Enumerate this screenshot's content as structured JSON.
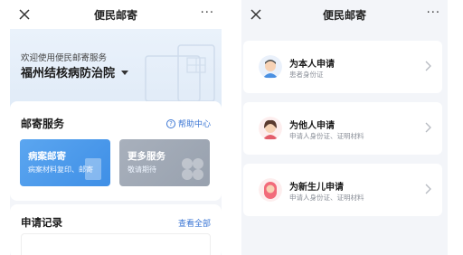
{
  "left": {
    "nav": {
      "title": "便民邮寄",
      "more": "···"
    },
    "welcome": "欢迎使用便民邮寄服务",
    "hospital": "福州结核病防治院",
    "service": {
      "title": "邮寄服务",
      "help": "帮助中心",
      "tiles": [
        {
          "title": "病案邮寄",
          "sub": "病案材料复印、邮寄"
        },
        {
          "title": "更多服务",
          "sub": "敬请期待"
        }
      ]
    },
    "records": {
      "title": "申请记录",
      "view_all": "查看全部"
    }
  },
  "right": {
    "nav": {
      "title": "便民邮寄",
      "more": "···"
    },
    "options": [
      {
        "label": "为本人申请",
        "desc": "患者身份证"
      },
      {
        "label": "为他人申请",
        "desc": "申请人身份证、证明材料"
      },
      {
        "label": "为新生儿申请",
        "desc": "申请人身份证、证明材料"
      }
    ]
  },
  "colors": {
    "accent": "#3b76d4",
    "tile_blue": "#4a99ec",
    "tile_gray": "#a1a9b5"
  }
}
